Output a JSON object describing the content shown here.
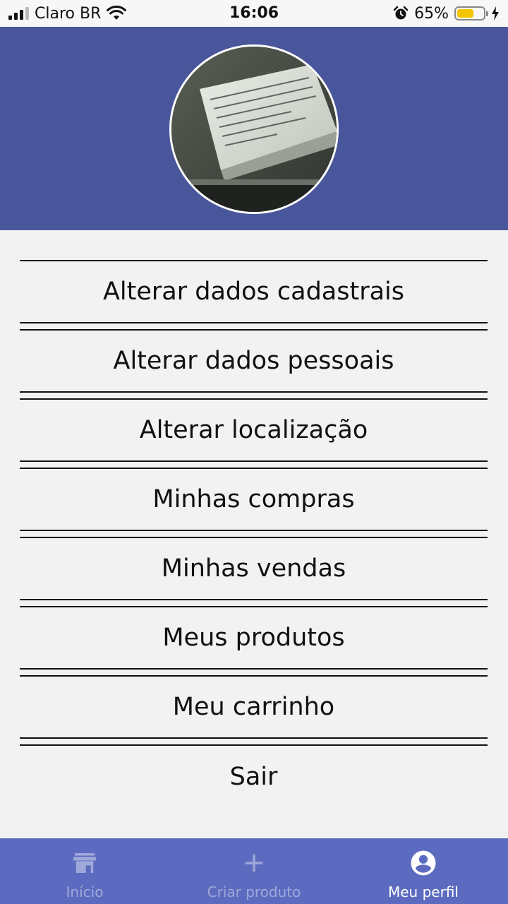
{
  "status_bar": {
    "carrier": "Claro BR",
    "time": "16:06",
    "battery": "65%",
    "battery_level": 0.65
  },
  "profile": {
    "avatar_icon": "profile-photo"
  },
  "menu": {
    "items": [
      {
        "label": "Alterar dados cadastrais"
      },
      {
        "label": "Alterar dados pessoais"
      },
      {
        "label": "Alterar localização"
      },
      {
        "label": "Minhas compras"
      },
      {
        "label": "Minhas vendas"
      },
      {
        "label": "Meus produtos"
      },
      {
        "label": "Meu carrinho"
      },
      {
        "label": "Sair"
      }
    ]
  },
  "tab_bar": {
    "tabs": [
      {
        "label": "Início",
        "icon": "store-icon",
        "active": false
      },
      {
        "label": "Criar produto",
        "icon": "plus-icon",
        "active": false
      },
      {
        "label": "Meu perfil",
        "icon": "account-circle-icon",
        "active": true
      }
    ]
  },
  "colors": {
    "header_bg": "#4a569b",
    "tab_bar_bg": "#5c6bbf",
    "page_bg": "#f2f2f2",
    "battery_fill": "#f5c400"
  }
}
